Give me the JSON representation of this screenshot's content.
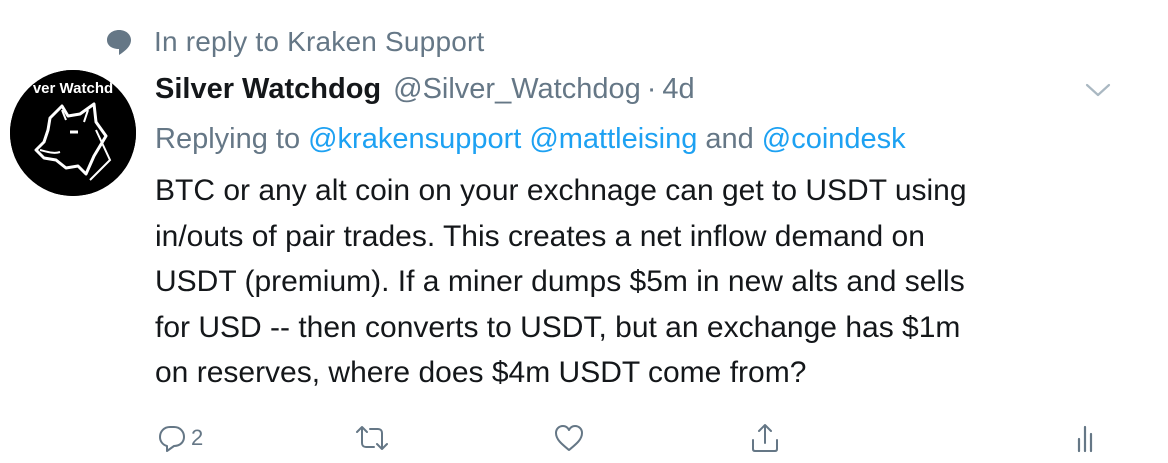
{
  "context": {
    "icon": "speech-bubble-icon",
    "text": "In reply to Kraken Support"
  },
  "tweet": {
    "avatar_text": "ver Watchd",
    "display_name": "Silver Watchdog",
    "handle": "@Silver_Watchdog",
    "separator": "·",
    "time": "4d",
    "menu_icon": "chevron-down-icon",
    "replying_prefix": "Replying to",
    "mentions": [
      "@krakensupport",
      "@mattleising"
    ],
    "and_text": "and",
    "last_mention": "@coindesk",
    "body_lines": [
      "BTC or any alt coin on your exchnage can get to USDT using",
      "in/outs of pair trades. This creates a net inflow demand on",
      "USDT (premium). If a miner dumps $5m in new alts and sells",
      "for USD -- then converts to USDT, but an exchange has $1m",
      "on reserves, where does $4m USDT come from?"
    ]
  },
  "actions": {
    "reply_count": "2",
    "icons": [
      "reply-icon",
      "retweet-icon",
      "like-icon",
      "share-icon",
      "analytics-icon"
    ]
  },
  "colors": {
    "text": "#14171a",
    "secondary": "#657786",
    "link": "#1da1f2"
  }
}
